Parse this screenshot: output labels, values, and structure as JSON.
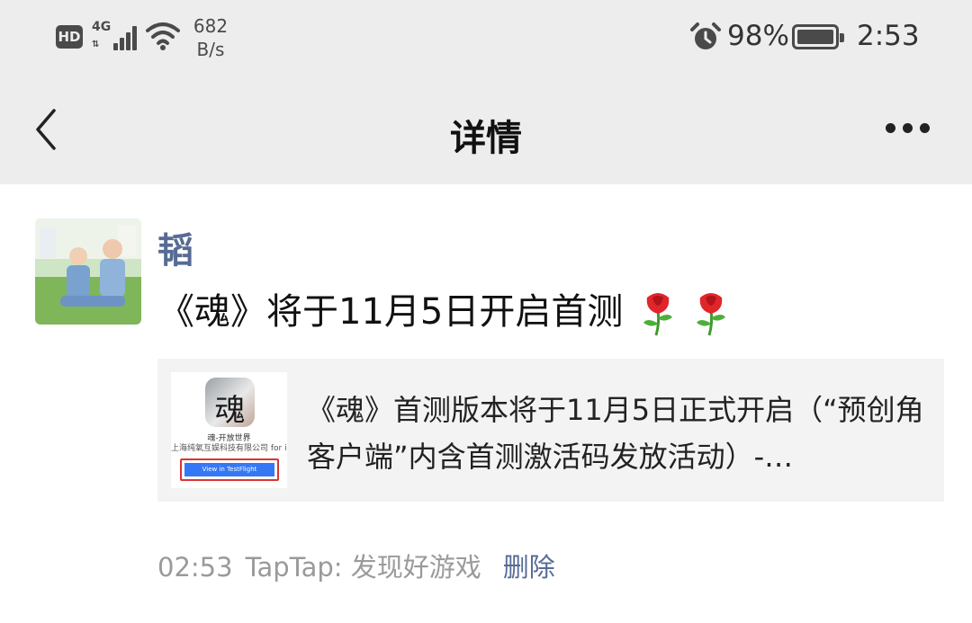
{
  "status_bar": {
    "hd_label": "HD",
    "network": "4G",
    "speed_value": "682",
    "speed_unit": "B/s",
    "battery_percent": "98%",
    "time": "2:53",
    "icons": [
      "hd-icon",
      "signal-icon",
      "wifi-icon",
      "alarm-icon",
      "battery-icon"
    ]
  },
  "nav": {
    "title": "详情",
    "back_icon": "chevron-left-icon",
    "more_icon": "more-dots-icon"
  },
  "post": {
    "username": "韬",
    "text": "《魂》将于11月5日开启首测",
    "emoji": [
      "rose",
      "rose"
    ],
    "link_card": {
      "thumb_app_char": "魂",
      "thumb_title": "魂-开放世界",
      "thumb_company": "上海纯氧互娱科技有限公司 for iOS",
      "thumb_button": "View in TestFlight",
      "text": "《魂》首测版本将于11月5日正式开启（“预创角客户端”内含首测激活码发放活动）-…"
    },
    "time": "02:53",
    "source": "TapTap: 发现好游戏",
    "delete_label": "删除"
  },
  "colors": {
    "link_blue": "#576b95",
    "top_background": "#ededed",
    "card_background": "#f3f3f3",
    "meta_gray": "#9a9a9a"
  }
}
